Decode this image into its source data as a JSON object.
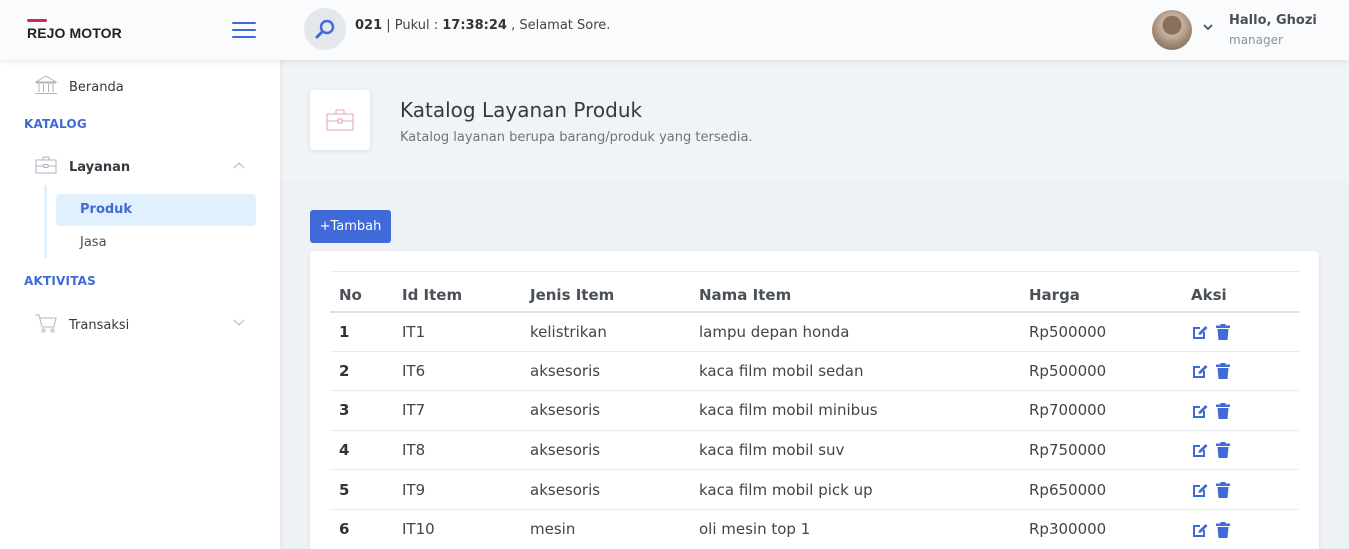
{
  "header": {
    "logo_text": "REJO MOTOR",
    "info_date": "021",
    "info_time_label": " | Pukul : ",
    "info_time": "17:38:24",
    "info_greeting": " , Selamat Sore.",
    "user_name": "Hallo, Ghozi",
    "user_role": "manager",
    "icons": [
      "menu-icon",
      "search-icon",
      "chevron-down-icon"
    ]
  },
  "sidebar": {
    "beranda": "Beranda",
    "heading_katalog": "KATALOG",
    "layanan": "Layanan",
    "layanan_sub": [
      {
        "label": "Produk",
        "active": true
      },
      {
        "label": "Jasa",
        "active": false
      }
    ],
    "heading_aktivitas": "AKTIVITAS",
    "transaksi": "Transaksi"
  },
  "page": {
    "title": "Katalog Layanan Produk",
    "subtitle": "Katalog layanan berupa barang/produk yang tersedia."
  },
  "toolbar": {
    "add_label": "+Tambah"
  },
  "table": {
    "headers": [
      "No",
      "Id Item",
      "Jenis Item",
      "Nama Item",
      "Harga",
      "Aksi"
    ],
    "rows": [
      [
        "1",
        "IT1",
        "kelistrikan",
        "lampu depan honda",
        "Rp500000"
      ],
      [
        "2",
        "IT6",
        "aksesoris",
        "kaca film mobil sedan",
        "Rp500000"
      ],
      [
        "3",
        "IT7",
        "aksesoris",
        "kaca film mobil minibus",
        "Rp700000"
      ],
      [
        "4",
        "IT8",
        "aksesoris",
        "kaca film mobil suv",
        "Rp750000"
      ],
      [
        "5",
        "IT9",
        "aksesoris",
        "kaca film mobil pick up",
        "Rp650000"
      ],
      [
        "6",
        "IT10",
        "mesin",
        "oli mesin top 1",
        "Rp300000"
      ]
    ]
  },
  "colors": {
    "primary": "#3f6ad8",
    "logo_accent": "#d92550",
    "active_bg": "#e0f0fd"
  }
}
